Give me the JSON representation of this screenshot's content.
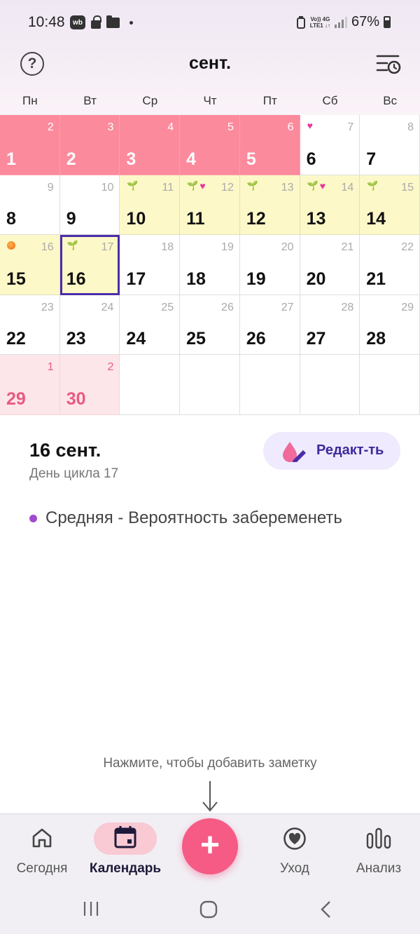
{
  "status_bar": {
    "time": "10:48",
    "wb_label": "wb",
    "network_top": "Vo)) 4G",
    "network_bottom": "LTE1 ↓↑",
    "battery": "67%"
  },
  "header": {
    "month": "сент."
  },
  "weekdays": [
    "Пн",
    "Вт",
    "Ср",
    "Чт",
    "Пт",
    "Сб",
    "Вс"
  ],
  "calendar": {
    "cells": [
      {
        "day": "1",
        "cycle": "2",
        "type": "period"
      },
      {
        "day": "2",
        "cycle": "3",
        "type": "period"
      },
      {
        "day": "3",
        "cycle": "4",
        "type": "period"
      },
      {
        "day": "4",
        "cycle": "5",
        "type": "period"
      },
      {
        "day": "5",
        "cycle": "6",
        "type": "period"
      },
      {
        "day": "6",
        "cycle": "7",
        "type": "normal",
        "marks": [
          "heart"
        ]
      },
      {
        "day": "7",
        "cycle": "8",
        "type": "normal"
      },
      {
        "day": "8",
        "cycle": "9",
        "type": "normal"
      },
      {
        "day": "9",
        "cycle": "10",
        "type": "normal"
      },
      {
        "day": "10",
        "cycle": "11",
        "type": "fertile",
        "marks": [
          "sprout"
        ]
      },
      {
        "day": "11",
        "cycle": "12",
        "type": "fertile",
        "marks": [
          "sprout",
          "heart"
        ]
      },
      {
        "day": "12",
        "cycle": "13",
        "type": "fertile",
        "marks": [
          "sprout"
        ]
      },
      {
        "day": "13",
        "cycle": "14",
        "type": "fertile",
        "marks": [
          "sprout",
          "heart"
        ]
      },
      {
        "day": "14",
        "cycle": "15",
        "type": "fertile",
        "marks": [
          "sprout"
        ]
      },
      {
        "day": "15",
        "cycle": "16",
        "type": "fertile",
        "marks": [
          "ovulation"
        ]
      },
      {
        "day": "16",
        "cycle": "17",
        "type": "fertile",
        "marks": [
          "sprout"
        ],
        "today": true
      },
      {
        "day": "17",
        "cycle": "18",
        "type": "normal"
      },
      {
        "day": "18",
        "cycle": "19",
        "type": "normal"
      },
      {
        "day": "19",
        "cycle": "20",
        "type": "normal"
      },
      {
        "day": "20",
        "cycle": "21",
        "type": "normal"
      },
      {
        "day": "21",
        "cycle": "22",
        "type": "normal"
      },
      {
        "day": "22",
        "cycle": "23",
        "type": "normal"
      },
      {
        "day": "23",
        "cycle": "24",
        "type": "normal"
      },
      {
        "day": "24",
        "cycle": "25",
        "type": "normal"
      },
      {
        "day": "25",
        "cycle": "26",
        "type": "normal"
      },
      {
        "day": "26",
        "cycle": "27",
        "type": "normal"
      },
      {
        "day": "27",
        "cycle": "28",
        "type": "normal"
      },
      {
        "day": "28",
        "cycle": "29",
        "type": "normal"
      },
      {
        "day": "29",
        "cycle": "1",
        "type": "predicted"
      },
      {
        "day": "30",
        "cycle": "2",
        "type": "predicted"
      },
      {
        "day": "",
        "cycle": "",
        "type": "empty"
      },
      {
        "day": "",
        "cycle": "",
        "type": "empty"
      },
      {
        "day": "",
        "cycle": "",
        "type": "empty"
      },
      {
        "day": "",
        "cycle": "",
        "type": "empty"
      },
      {
        "day": "",
        "cycle": "",
        "type": "empty"
      }
    ]
  },
  "detail": {
    "selected_date": "16 сент.",
    "cycle_day": "День цикла 17",
    "edit_label": "Редакт-ть",
    "info": "Средняя - Вероятность забеременеть"
  },
  "hint": "Нажмите, чтобы добавить заметку",
  "nav": {
    "today": "Сегодня",
    "calendar": "Календарь",
    "add": "+",
    "care": "Уход",
    "analysis": "Анализ"
  },
  "colors": {
    "period": "#fb8a9c",
    "fertile": "#fdf8c8",
    "predicted": "#fde6ea",
    "accent": "#f55b85",
    "today_border": "#4a2ea8"
  }
}
